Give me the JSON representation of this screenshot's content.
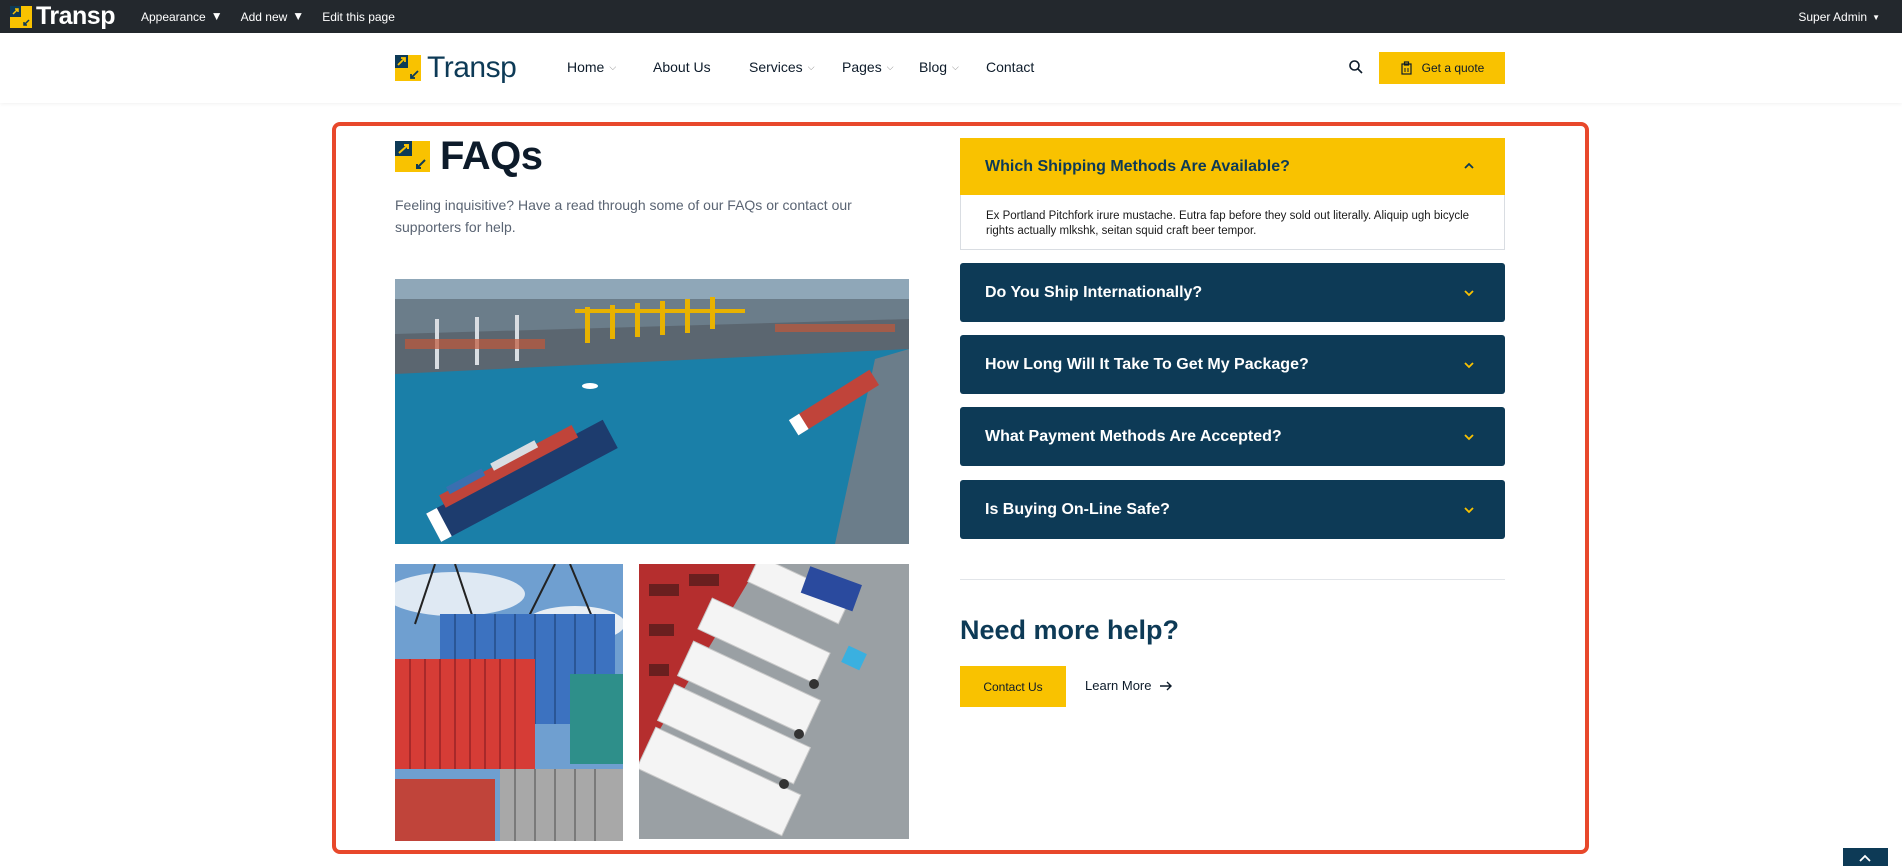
{
  "admin_bar": {
    "brand": "Transp",
    "menu": [
      "Appearance",
      "Add new",
      "Edit this page"
    ],
    "user": "Super Admin"
  },
  "header": {
    "brand": "Transp",
    "nav": [
      {
        "label": "Home",
        "dropdown": true
      },
      {
        "label": "About Us",
        "dropdown": false
      },
      {
        "label": "Services",
        "dropdown": true
      },
      {
        "label": "Pages",
        "dropdown": true
      },
      {
        "label": "Blog",
        "dropdown": true
      },
      {
        "label": "Contact",
        "dropdown": false
      }
    ],
    "quote_label": "Get a quote"
  },
  "main": {
    "title": "FAQs",
    "intro": "Feeling inquisitive? Have a read through some of our FAQs or contact our supporters for help.",
    "faqs": [
      {
        "question": "Which Shipping Methods Are Available?",
        "answer": "Ex Portland Pitchfork irure mustache. Eutra fap before they sold out literally. Aliquip ugh bicycle rights actually mlkshk, seitan squid craft beer tempor.",
        "open": true
      },
      {
        "question": "Do You Ship Internationally?",
        "open": false
      },
      {
        "question": "How Long Will It Take To Get My Package?",
        "open": false
      },
      {
        "question": "What Payment Methods Are Accepted?",
        "open": false
      },
      {
        "question": "Is Buying On-Line Safe?",
        "open": false
      }
    ],
    "help_title": "Need more help?",
    "contact_label": "Contact Us",
    "learn_more_label": "Learn More"
  },
  "colors": {
    "accent": "#f9c200",
    "navy": "#0d3a56",
    "highlight": "#e8482b",
    "admin_bg": "#23282d"
  }
}
